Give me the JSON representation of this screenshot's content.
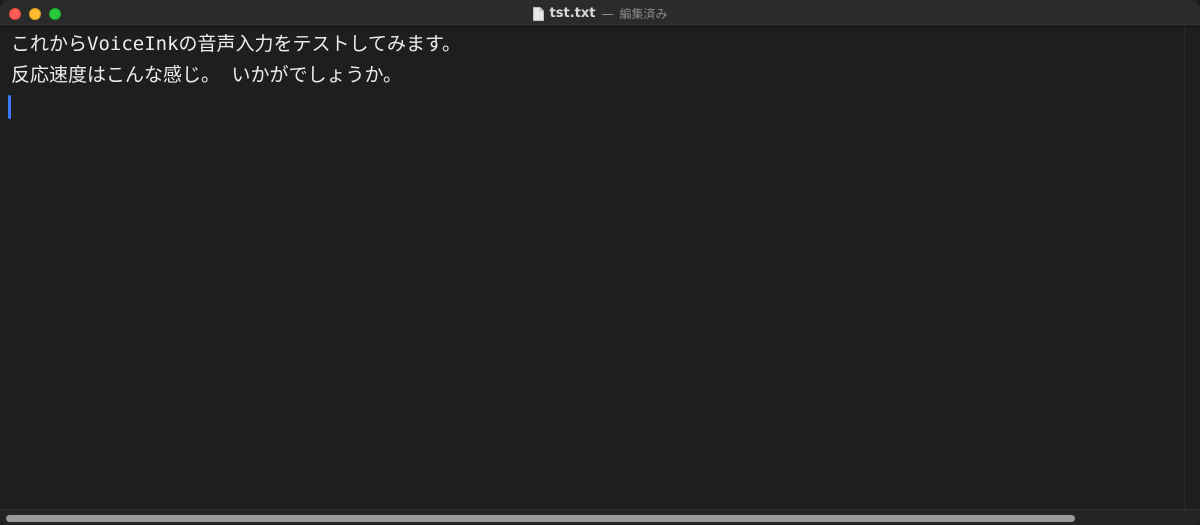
{
  "window": {
    "title": "tst.txt",
    "separator": "—",
    "status": "編集済み",
    "document_icon": "document-icon"
  },
  "traffic_lights": {
    "close_color": "#ff5f57",
    "minimize_color": "#febc2e",
    "zoom_color": "#28c840"
  },
  "editor": {
    "lines": [
      "これからVoiceInkの音声入力をテストしてみます。",
      "反応速度はこんな感じ。 いかがでしょうか。",
      ""
    ],
    "caret_color": "#3b78ff"
  },
  "scrollbar": {
    "horizontal_position_fraction": 0.0,
    "horizontal_visible_fraction": 0.9
  }
}
